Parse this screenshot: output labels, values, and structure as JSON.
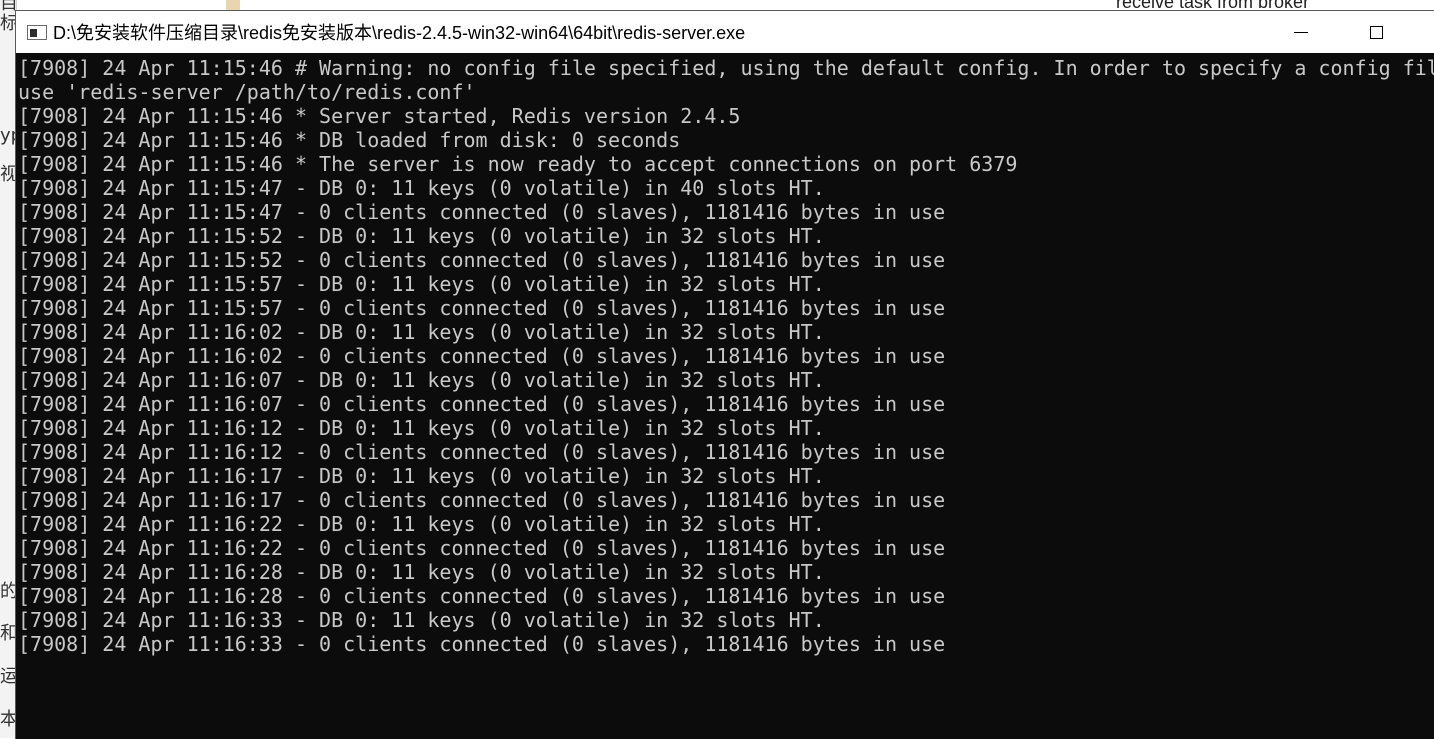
{
  "background": {
    "top_text": "receive task from broker",
    "left_chars": [
      "目标",
      "yp",
      "视",
      "的",
      "和",
      "运",
      "本"
    ]
  },
  "window": {
    "title": "D:\\免安装软件压缩目录\\redis免安装版本\\redis-2.4.5-win32-win64\\64bit\\redis-server.exe",
    "minimize_label": "—",
    "maximize_label": "☐"
  },
  "console": {
    "lines": [
      "[7908] 24 Apr 11:15:46 # Warning: no config file specified, using the default config. In order to specify a config file",
      "use 'redis-server /path/to/redis.conf'",
      "[7908] 24 Apr 11:15:46 * Server started, Redis version 2.4.5",
      "[7908] 24 Apr 11:15:46 * DB loaded from disk: 0 seconds",
      "[7908] 24 Apr 11:15:46 * The server is now ready to accept connections on port 6379",
      "[7908] 24 Apr 11:15:47 - DB 0: 11 keys (0 volatile) in 40 slots HT.",
      "[7908] 24 Apr 11:15:47 - 0 clients connected (0 slaves), 1181416 bytes in use",
      "[7908] 24 Apr 11:15:52 - DB 0: 11 keys (0 volatile) in 32 slots HT.",
      "[7908] 24 Apr 11:15:52 - 0 clients connected (0 slaves), 1181416 bytes in use",
      "[7908] 24 Apr 11:15:57 - DB 0: 11 keys (0 volatile) in 32 slots HT.",
      "[7908] 24 Apr 11:15:57 - 0 clients connected (0 slaves), 1181416 bytes in use",
      "[7908] 24 Apr 11:16:02 - DB 0: 11 keys (0 volatile) in 32 slots HT.",
      "[7908] 24 Apr 11:16:02 - 0 clients connected (0 slaves), 1181416 bytes in use",
      "[7908] 24 Apr 11:16:07 - DB 0: 11 keys (0 volatile) in 32 slots HT.",
      "[7908] 24 Apr 11:16:07 - 0 clients connected (0 slaves), 1181416 bytes in use",
      "[7908] 24 Apr 11:16:12 - DB 0: 11 keys (0 volatile) in 32 slots HT.",
      "[7908] 24 Apr 11:16:12 - 0 clients connected (0 slaves), 1181416 bytes in use",
      "[7908] 24 Apr 11:16:17 - DB 0: 11 keys (0 volatile) in 32 slots HT.",
      "[7908] 24 Apr 11:16:17 - 0 clients connected (0 slaves), 1181416 bytes in use",
      "[7908] 24 Apr 11:16:22 - DB 0: 11 keys (0 volatile) in 32 slots HT.",
      "[7908] 24 Apr 11:16:22 - 0 clients connected (0 slaves), 1181416 bytes in use",
      "[7908] 24 Apr 11:16:28 - DB 0: 11 keys (0 volatile) in 32 slots HT.",
      "[7908] 24 Apr 11:16:28 - 0 clients connected (0 slaves), 1181416 bytes in use",
      "[7908] 24 Apr 11:16:33 - DB 0: 11 keys (0 volatile) in 32 slots HT.",
      "[7908] 24 Apr 11:16:33 - 0 clients connected (0 slaves), 1181416 bytes in use"
    ]
  },
  "colors": {
    "console_background": "#0c0c0c",
    "console_text": "#c8c8c8",
    "titlebar_background": "#ffffff"
  }
}
